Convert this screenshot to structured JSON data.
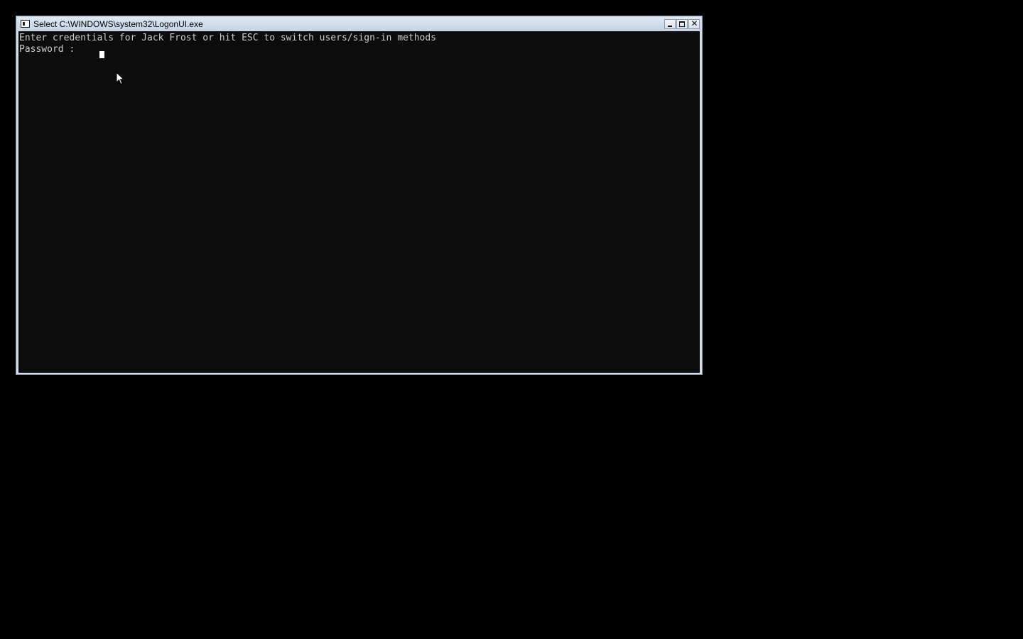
{
  "window": {
    "title": "Select C:\\WINDOWS\\system32\\LogonUI.exe",
    "icon": "console-app-icon",
    "controls": {
      "minimize": "minimize-icon",
      "maximize": "maximize-icon",
      "close": "close-icon",
      "close_glyph": "✕"
    }
  },
  "console": {
    "lines": [
      "Enter credentials for Jack Frost or hit ESC to switch users/sign-in methods",
      "Password :"
    ]
  },
  "colors": {
    "desktop_background": "#000000",
    "console_background": "#0c0c0c",
    "console_text": "#cccccc",
    "title_bar": "#dfe8f3"
  }
}
